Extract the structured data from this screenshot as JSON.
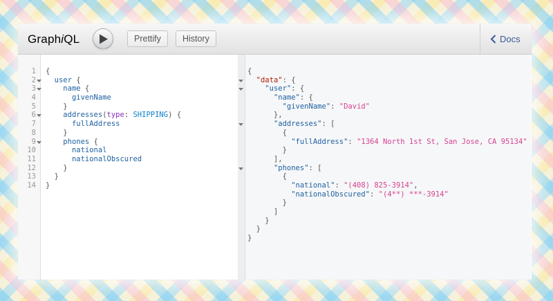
{
  "app": {
    "title_prefix": "Graph",
    "title_italic": "i",
    "title_suffix": "QL"
  },
  "toolbar": {
    "prettify_label": "Prettify",
    "history_label": "History",
    "docs_label": "Docs"
  },
  "icons": {
    "execute": "play-icon",
    "docs": "chevron-left-icon",
    "fold": "fold-arrow-icon"
  },
  "colors": {
    "field": "#1f61a0",
    "string": "#d64292",
    "keyword": "#b11a04",
    "argument": "#8b2bb9",
    "line_number": "#999999"
  },
  "query": {
    "line_numbers": [
      "1",
      "2",
      "3",
      "4",
      "5",
      "6",
      "7",
      "8",
      "9",
      "10",
      "11",
      "12",
      "13",
      "14"
    ],
    "lines": [
      [
        {
          "t": "{",
          "c": "punct"
        }
      ],
      [
        {
          "t": "  ",
          "c": "punct"
        },
        {
          "t": "user",
          "c": "field"
        },
        {
          "t": " {",
          "c": "punct"
        }
      ],
      [
        {
          "t": "    ",
          "c": "punct"
        },
        {
          "t": "name",
          "c": "field"
        },
        {
          "t": " {",
          "c": "punct"
        }
      ],
      [
        {
          "t": "      ",
          "c": "punct"
        },
        {
          "t": "givenName",
          "c": "field"
        }
      ],
      [
        {
          "t": "    }",
          "c": "punct"
        }
      ],
      [
        {
          "t": "    ",
          "c": "punct"
        },
        {
          "t": "addresses",
          "c": "field"
        },
        {
          "t": "(",
          "c": "punct"
        },
        {
          "t": "type",
          "c": "arg"
        },
        {
          "t": ": ",
          "c": "punct"
        },
        {
          "t": "SHIPPING",
          "c": "enum"
        },
        {
          "t": ") {",
          "c": "punct"
        }
      ],
      [
        {
          "t": "      ",
          "c": "punct"
        },
        {
          "t": "fullAddress",
          "c": "field"
        }
      ],
      [
        {
          "t": "    }",
          "c": "punct"
        }
      ],
      [
        {
          "t": "    ",
          "c": "punct"
        },
        {
          "t": "phones",
          "c": "field"
        },
        {
          "t": " {",
          "c": "punct"
        }
      ],
      [
        {
          "t": "      ",
          "c": "punct"
        },
        {
          "t": "national",
          "c": "field"
        }
      ],
      [
        {
          "t": "      ",
          "c": "punct"
        },
        {
          "t": "nationalObscured",
          "c": "field"
        }
      ],
      [
        {
          "t": "    }",
          "c": "punct"
        }
      ],
      [
        {
          "t": "  }",
          "c": "punct"
        }
      ],
      [
        {
          "t": "}",
          "c": "punct"
        }
      ]
    ],
    "fold_rows": [
      false,
      true,
      true,
      false,
      false,
      true,
      false,
      false,
      true,
      false,
      false,
      false,
      false,
      false
    ]
  },
  "result": {
    "lines": [
      [
        {
          "t": "{",
          "c": "punct"
        }
      ],
      [
        {
          "t": "  ",
          "c": "punct"
        },
        {
          "t": "\"data\"",
          "c": "keyred"
        },
        {
          "t": ": {",
          "c": "punct"
        }
      ],
      [
        {
          "t": "    ",
          "c": "punct"
        },
        {
          "t": "\"user\"",
          "c": "key"
        },
        {
          "t": ": {",
          "c": "punct"
        }
      ],
      [
        {
          "t": "      ",
          "c": "punct"
        },
        {
          "t": "\"name\"",
          "c": "key"
        },
        {
          "t": ": {",
          "c": "punct"
        }
      ],
      [
        {
          "t": "        ",
          "c": "punct"
        },
        {
          "t": "\"givenName\"",
          "c": "key"
        },
        {
          "t": ": ",
          "c": "punct"
        },
        {
          "t": "\"David\"",
          "c": "str"
        }
      ],
      [
        {
          "t": "      },",
          "c": "punct"
        }
      ],
      [
        {
          "t": "      ",
          "c": "punct"
        },
        {
          "t": "\"addresses\"",
          "c": "key"
        },
        {
          "t": ": [",
          "c": "punct"
        }
      ],
      [
        {
          "t": "        {",
          "c": "punct"
        }
      ],
      [
        {
          "t": "          ",
          "c": "punct"
        },
        {
          "t": "\"fullAddress\"",
          "c": "key"
        },
        {
          "t": ": ",
          "c": "punct"
        },
        {
          "t": "\"1364 North 1st St, San Jose, CA 95134\"",
          "c": "str"
        }
      ],
      [
        {
          "t": "        }",
          "c": "punct"
        }
      ],
      [
        {
          "t": "      ],",
          "c": "punct"
        }
      ],
      [
        {
          "t": "      ",
          "c": "punct"
        },
        {
          "t": "\"phones\"",
          "c": "key"
        },
        {
          "t": ": [",
          "c": "punct"
        }
      ],
      [
        {
          "t": "        {",
          "c": "punct"
        }
      ],
      [
        {
          "t": "          ",
          "c": "punct"
        },
        {
          "t": "\"national\"",
          "c": "key"
        },
        {
          "t": ": ",
          "c": "punct"
        },
        {
          "t": "\"(408) 825-3914\"",
          "c": "str"
        },
        {
          "t": ",",
          "c": "punct"
        }
      ],
      [
        {
          "t": "          ",
          "c": "punct"
        },
        {
          "t": "\"nationalObscured\"",
          "c": "key"
        },
        {
          "t": ": ",
          "c": "punct"
        },
        {
          "t": "\"(4**) ***-3914\"",
          "c": "str"
        }
      ],
      [
        {
          "t": "        }",
          "c": "punct"
        }
      ],
      [
        {
          "t": "      ]",
          "c": "punct"
        }
      ],
      [
        {
          "t": "    }",
          "c": "punct"
        }
      ],
      [
        {
          "t": "  }",
          "c": "punct"
        }
      ],
      [
        {
          "t": "}",
          "c": "punct"
        }
      ]
    ],
    "fold_rows": [
      false,
      true,
      true,
      false,
      false,
      false,
      true,
      false,
      false,
      false,
      false,
      true,
      false,
      false,
      false,
      false,
      false,
      false,
      false,
      false
    ]
  }
}
